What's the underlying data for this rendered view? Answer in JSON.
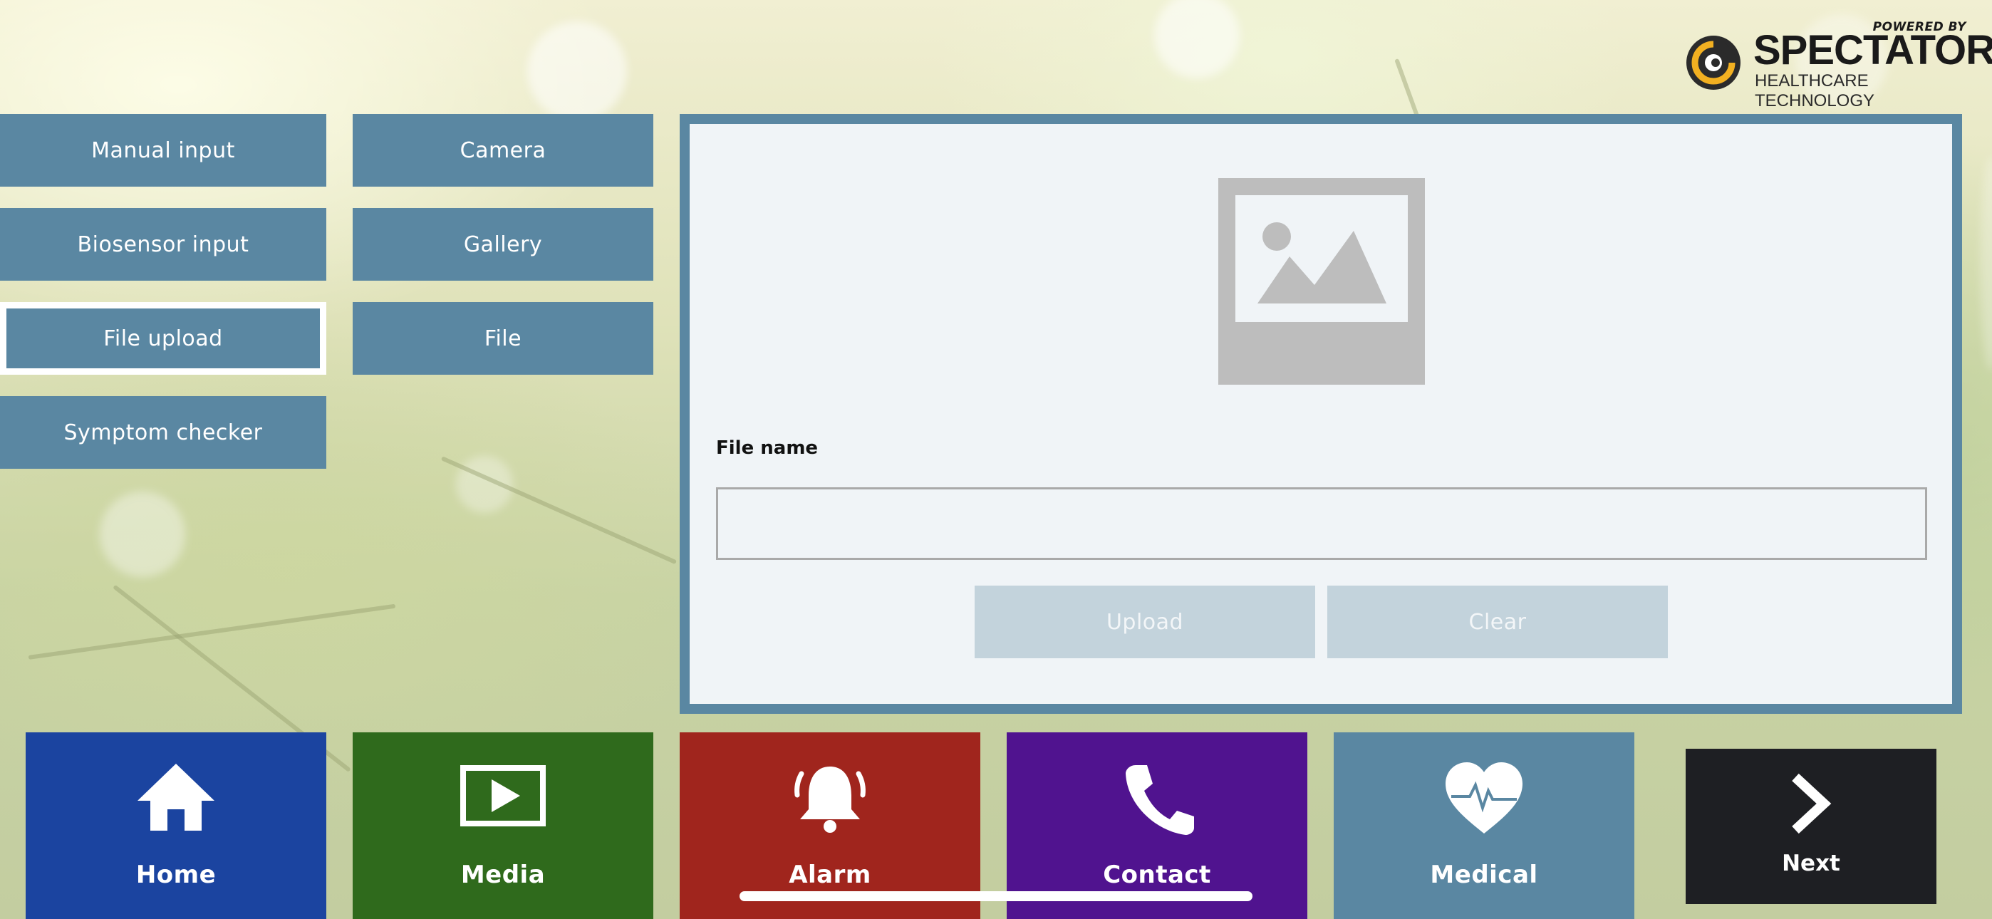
{
  "logo": {
    "powered_by": "POWERED BY",
    "brand": "SPECTATOR",
    "tagline": "HEALTHCARE TECHNOLOGY"
  },
  "menu": {
    "manual_input": "Manual input",
    "camera": "Camera",
    "biosensor_input": "Biosensor input",
    "gallery": "Gallery",
    "file_upload": "File upload",
    "file": "File",
    "symptom_checker": "Symptom checker"
  },
  "panel": {
    "file_name_label": "File name",
    "file_name_value": "",
    "upload_label": "Upload",
    "clear_label": "Clear"
  },
  "nav": {
    "home": "Home",
    "media": "Media",
    "alarm": "Alarm",
    "contact": "Contact",
    "medical": "Medical",
    "next": "Next"
  },
  "colors": {
    "menu_blue": "#5a87a2",
    "home": "#1b44a0",
    "media": "#2f6a1c",
    "alarm": "#a0251d",
    "contact": "#50138f",
    "medical": "#5a87a2",
    "next": "#1e1f23",
    "disabled_button": "#c3d3dc"
  },
  "icons": {
    "home": "house-icon",
    "media": "play-icon",
    "alarm": "bell-icon",
    "contact": "phone-icon",
    "medical": "heart-pulse-icon",
    "next": "chevron-right-icon",
    "placeholder": "image-placeholder-icon"
  }
}
